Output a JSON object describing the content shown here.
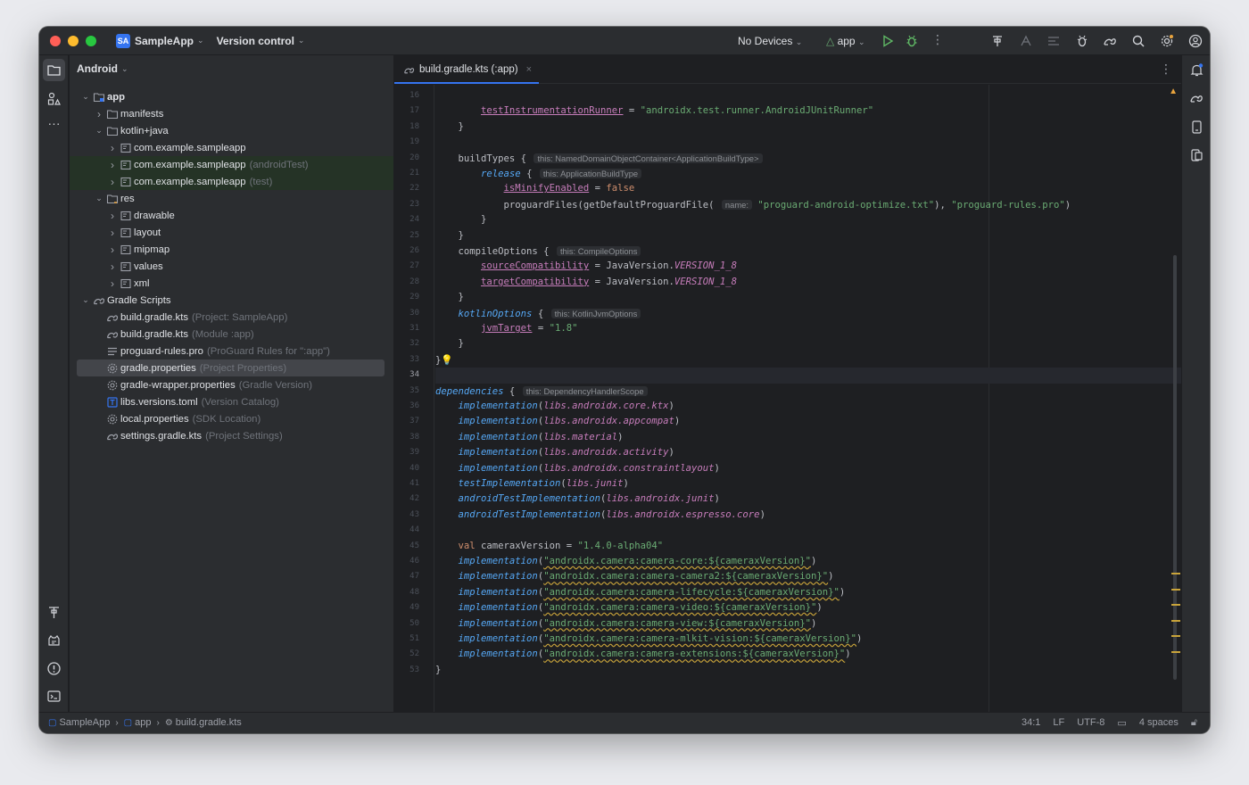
{
  "titlebar": {
    "project_badge": "SA",
    "project_name": "SampleApp",
    "version_control": "Version control",
    "devices": "No Devices",
    "run_config": "app"
  },
  "project_panel": {
    "view_mode": "Android",
    "tree": [
      {
        "label": "app",
        "hint": "",
        "depth": 0,
        "arrow": "down",
        "icon": "module-folder-icon",
        "style": "bold"
      },
      {
        "label": "manifests",
        "hint": "",
        "depth": 1,
        "arrow": "right",
        "icon": "folder-icon",
        "style": ""
      },
      {
        "label": "kotlin+java",
        "hint": "",
        "depth": 1,
        "arrow": "down",
        "icon": "folder-icon",
        "style": ""
      },
      {
        "label": "com.example.sampleapp",
        "hint": "",
        "depth": 2,
        "arrow": "right",
        "icon": "package-icon",
        "style": ""
      },
      {
        "label": "com.example.sampleapp",
        "hint": "(androidTest)",
        "depth": 2,
        "arrow": "right",
        "icon": "package-icon",
        "style": "green"
      },
      {
        "label": "com.example.sampleapp",
        "hint": "(test)",
        "depth": 2,
        "arrow": "right",
        "icon": "package-icon",
        "style": "green"
      },
      {
        "label": "res",
        "hint": "",
        "depth": 1,
        "arrow": "down",
        "icon": "res-folder-icon",
        "style": ""
      },
      {
        "label": "drawable",
        "hint": "",
        "depth": 2,
        "arrow": "right",
        "icon": "package-icon",
        "style": ""
      },
      {
        "label": "layout",
        "hint": "",
        "depth": 2,
        "arrow": "right",
        "icon": "package-icon",
        "style": ""
      },
      {
        "label": "mipmap",
        "hint": "",
        "depth": 2,
        "arrow": "right",
        "icon": "package-icon",
        "style": ""
      },
      {
        "label": "values",
        "hint": "",
        "depth": 2,
        "arrow": "right",
        "icon": "package-icon",
        "style": ""
      },
      {
        "label": "xml",
        "hint": "",
        "depth": 2,
        "arrow": "right",
        "icon": "package-icon",
        "style": ""
      },
      {
        "label": "Gradle Scripts",
        "hint": "",
        "depth": 0,
        "arrow": "down",
        "icon": "gradle-icon",
        "style": ""
      },
      {
        "label": "build.gradle.kts",
        "hint": "(Project: SampleApp)",
        "depth": 1,
        "arrow": "",
        "icon": "gradle-icon",
        "style": ""
      },
      {
        "label": "build.gradle.kts",
        "hint": "(Module :app)",
        "depth": 1,
        "arrow": "",
        "icon": "gradle-icon",
        "style": ""
      },
      {
        "label": "proguard-rules.pro",
        "hint": "(ProGuard Rules for \":app\")",
        "depth": 1,
        "arrow": "",
        "icon": "text-file-icon",
        "style": ""
      },
      {
        "label": "gradle.properties",
        "hint": "(Project Properties)",
        "depth": 1,
        "arrow": "",
        "icon": "settings-file-icon",
        "style": "sel"
      },
      {
        "label": "gradle-wrapper.properties",
        "hint": "(Gradle Version)",
        "depth": 1,
        "arrow": "",
        "icon": "settings-file-icon",
        "style": ""
      },
      {
        "label": "libs.versions.toml",
        "hint": "(Version Catalog)",
        "depth": 1,
        "arrow": "",
        "icon": "toml-file-icon",
        "style": ""
      },
      {
        "label": "local.properties",
        "hint": "(SDK Location)",
        "depth": 1,
        "arrow": "",
        "icon": "settings-file-icon",
        "style": ""
      },
      {
        "label": "settings.gradle.kts",
        "hint": "(Project Settings)",
        "depth": 1,
        "arrow": "",
        "icon": "gradle-icon",
        "style": ""
      }
    ]
  },
  "editor": {
    "tab_label": "build.gradle.kts (:app)",
    "tab_close": "×",
    "first_line_number": 16,
    "current_line": 34,
    "lines": [
      [],
      [
        [
          "        ",
          ""
        ],
        [
          "testInstrumentationRunner",
          "prop"
        ],
        [
          " = ",
          ""
        ],
        [
          "\"androidx.test.runner.AndroidJUnitRunner\"",
          "str"
        ]
      ],
      [
        [
          "    }",
          ""
        ]
      ],
      [],
      [
        [
          "    buildTypes { ",
          ""
        ],
        [
          "this: NamedDomainObjectContainer<ApplicationBuildType>",
          "inl"
        ]
      ],
      [
        [
          "        ",
          ""
        ],
        [
          "release",
          "fn"
        ],
        [
          " { ",
          ""
        ],
        [
          "this: ApplicationBuildType",
          "inl"
        ]
      ],
      [
        [
          "            ",
          ""
        ],
        [
          "isMinifyEnabled",
          "prop"
        ],
        [
          " = ",
          ""
        ],
        [
          "false",
          "kw"
        ]
      ],
      [
        [
          "            proguardFiles(getDefaultProguardFile( ",
          ""
        ],
        [
          "name:",
          "inl"
        ],
        [
          " ",
          ""
        ],
        [
          "\"proguard-android-optimize.txt\"",
          "str"
        ],
        [
          "), ",
          ""
        ],
        [
          "\"proguard-rules.pro\"",
          "str"
        ],
        [
          ")",
          ""
        ]
      ],
      [
        [
          "        }",
          ""
        ]
      ],
      [
        [
          "    }",
          ""
        ]
      ],
      [
        [
          "    compileOptions { ",
          ""
        ],
        [
          "this: CompileOptions",
          "inl"
        ]
      ],
      [
        [
          "        ",
          ""
        ],
        [
          "sourceCompatibility",
          "prop"
        ],
        [
          " = JavaVersion.",
          ""
        ],
        [
          "VERSION_1_8",
          "cst"
        ]
      ],
      [
        [
          "        ",
          ""
        ],
        [
          "targetCompatibility",
          "prop"
        ],
        [
          " = JavaVersion.",
          ""
        ],
        [
          "VERSION_1_8",
          "cst"
        ]
      ],
      [
        [
          "    }",
          ""
        ]
      ],
      [
        [
          "    ",
          ""
        ],
        [
          "kotlinOptions",
          "fn"
        ],
        [
          " { ",
          ""
        ],
        [
          "this: KotlinJvmOptions",
          "inl"
        ]
      ],
      [
        [
          "        ",
          ""
        ],
        [
          "jvmTarget",
          "prop"
        ],
        [
          " = ",
          ""
        ],
        [
          "\"1.8\"",
          "str"
        ]
      ],
      [
        [
          "    }",
          ""
        ]
      ],
      [
        [
          "}",
          ""
        ],
        [
          "💡",
          "bulb"
        ]
      ],
      [],
      [
        [
          "dependencies",
          "fn"
        ],
        [
          " { ",
          ""
        ],
        [
          "this: DependencyHandlerScope",
          "inl"
        ]
      ],
      [
        [
          "    ",
          ""
        ],
        [
          "implementation",
          "fn"
        ],
        [
          "(",
          ""
        ],
        [
          "libs.androidx.core.ktx",
          "libs"
        ],
        [
          ")",
          ""
        ]
      ],
      [
        [
          "    ",
          ""
        ],
        [
          "implementation",
          "fn"
        ],
        [
          "(",
          ""
        ],
        [
          "libs.androidx.appcompat",
          "libs"
        ],
        [
          ")",
          ""
        ]
      ],
      [
        [
          "    ",
          ""
        ],
        [
          "implementation",
          "fn"
        ],
        [
          "(",
          ""
        ],
        [
          "libs.material",
          "libs"
        ],
        [
          ")",
          ""
        ]
      ],
      [
        [
          "    ",
          ""
        ],
        [
          "implementation",
          "fn"
        ],
        [
          "(",
          ""
        ],
        [
          "libs.androidx.activity",
          "libs"
        ],
        [
          ")",
          ""
        ]
      ],
      [
        [
          "    ",
          ""
        ],
        [
          "implementation",
          "fn"
        ],
        [
          "(",
          ""
        ],
        [
          "libs.androidx.constraintlayout",
          "libs"
        ],
        [
          ")",
          ""
        ]
      ],
      [
        [
          "    ",
          ""
        ],
        [
          "testImplementation",
          "fn"
        ],
        [
          "(",
          ""
        ],
        [
          "libs.junit",
          "libs"
        ],
        [
          ")",
          ""
        ]
      ],
      [
        [
          "    ",
          ""
        ],
        [
          "androidTestImplementation",
          "fn"
        ],
        [
          "(",
          ""
        ],
        [
          "libs.androidx.junit",
          "libs"
        ],
        [
          ")",
          ""
        ]
      ],
      [
        [
          "    ",
          ""
        ],
        [
          "androidTestImplementation",
          "fn"
        ],
        [
          "(",
          ""
        ],
        [
          "libs.androidx.espresso.core",
          "libs"
        ],
        [
          ")",
          ""
        ]
      ],
      [],
      [
        [
          "    ",
          ""
        ],
        [
          "val",
          "kw"
        ],
        [
          " cameraxVersion = ",
          ""
        ],
        [
          "\"1.4.0-alpha04\"",
          "str"
        ]
      ],
      [
        [
          "    ",
          ""
        ],
        [
          "implementation",
          "fn"
        ],
        [
          "(",
          ""
        ],
        [
          "\"androidx.camera:camera-core:${cameraxVersion}\"",
          "strwarn"
        ],
        [
          ")",
          ""
        ]
      ],
      [
        [
          "    ",
          ""
        ],
        [
          "implementation",
          "fn"
        ],
        [
          "(",
          ""
        ],
        [
          "\"androidx.camera:camera-camera2:${cameraxVersion}\"",
          "strwarn"
        ],
        [
          ")",
          ""
        ]
      ],
      [
        [
          "    ",
          ""
        ],
        [
          "implementation",
          "fn"
        ],
        [
          "(",
          ""
        ],
        [
          "\"androidx.camera:camera-lifecycle:${cameraxVersion}\"",
          "strwarn"
        ],
        [
          ")",
          ""
        ]
      ],
      [
        [
          "    ",
          ""
        ],
        [
          "implementation",
          "fn"
        ],
        [
          "(",
          ""
        ],
        [
          "\"androidx.camera:camera-video:${cameraxVersion}\"",
          "strwarn"
        ],
        [
          ")",
          ""
        ]
      ],
      [
        [
          "    ",
          ""
        ],
        [
          "implementation",
          "fn"
        ],
        [
          "(",
          ""
        ],
        [
          "\"androidx.camera:camera-view:${cameraxVersion}\"",
          "strwarn"
        ],
        [
          ")",
          ""
        ]
      ],
      [
        [
          "    ",
          ""
        ],
        [
          "implementation",
          "fn"
        ],
        [
          "(",
          ""
        ],
        [
          "\"androidx.camera:camera-mlkit-vision:${cameraxVersion}\"",
          "strwarn"
        ],
        [
          ")",
          ""
        ]
      ],
      [
        [
          "    ",
          ""
        ],
        [
          "implementation",
          "fn"
        ],
        [
          "(",
          ""
        ],
        [
          "\"androidx.camera:camera-extensions:${cameraxVersion}\"",
          "strwarn"
        ],
        [
          ")",
          ""
        ]
      ],
      [
        [
          "}",
          ""
        ]
      ]
    ]
  },
  "statusbar": {
    "crumbs": [
      "SampleApp",
      "app",
      "build.gradle.kts"
    ],
    "position": "34:1",
    "line_ending": "LF",
    "encoding": "UTF-8",
    "indent": "4 spaces"
  },
  "colors": {
    "accent": "#3574f0",
    "background": "#1e1f22",
    "panel": "#2b2d30",
    "warning": "#c9a43a"
  }
}
